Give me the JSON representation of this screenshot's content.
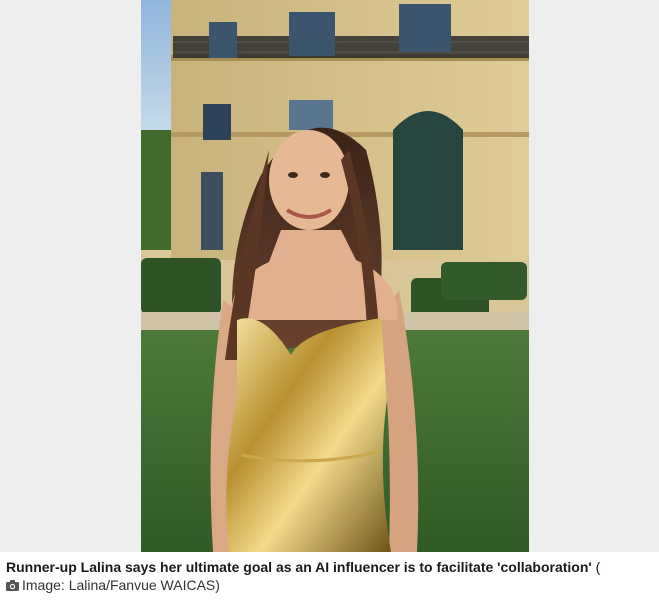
{
  "article": {
    "image": {
      "subject": "woman-in-gold-dress-photo"
    },
    "caption": {
      "text": "Runner-up Lalina says her ultimate goal as an AI influencer is to facilitate 'collaboration'",
      "open_paren": " (",
      "credit_icon": "camera-icon",
      "credit": "Image: Lalina/Fanvue WAICAS)"
    }
  },
  "colors": {
    "frame_background": "#eeeeee",
    "caption_text": "#1a1a1a"
  }
}
